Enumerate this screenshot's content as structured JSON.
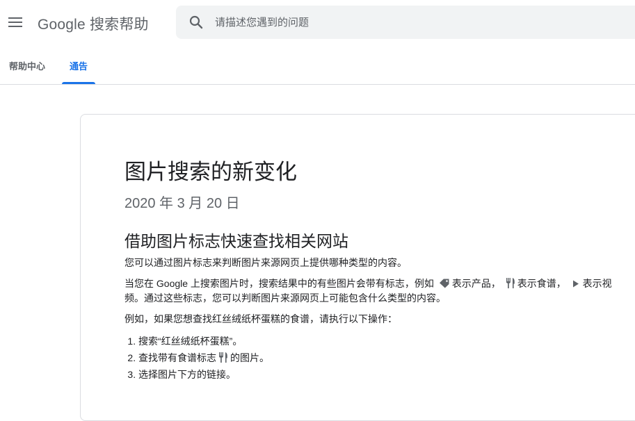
{
  "header": {
    "product_title": "Google 搜索帮助",
    "search_placeholder": "请描述您遇到的问题"
  },
  "tabs": [
    {
      "label": "帮助中心",
      "active": false
    },
    {
      "label": "通告",
      "active": true
    }
  ],
  "article": {
    "title": "图片搜索的新变化",
    "date": "2020 年 3 月 20 日",
    "section_heading": "借助图片标志快速查找相关网站",
    "intro": "您可以通过图片标志来判断图片来源网页上提供哪种类型的内容。",
    "badges_para": {
      "part1": "当您在 Google 上搜索图片时，搜索结果中的有些图片会带有标志，例如",
      "part2": "表示产品，",
      "part3": "表示食谱，",
      "part4": "表示视频。通过这些标志，您可以判断图片来源网页上可能包含什么类型的内容。"
    },
    "example_intro": "例如，如果您想查找红丝绒纸杯蛋糕的食谱，请执行以下操作：",
    "steps": {
      "step1": "搜索“红丝绒纸杯蛋糕”。",
      "step2_part1": "查找带有食谱标志",
      "step2_part2": "的图片。",
      "step3": "选择图片下方的链接。"
    }
  },
  "icons": {
    "menu": "menu-icon",
    "search": "search-icon",
    "product": "tag-icon",
    "recipe": "fork-knife-icon",
    "video": "play-icon"
  },
  "colors": {
    "accent": "#1a73e8",
    "search_bg": "#f1f3f4",
    "secondary_text": "#5f6368",
    "border": "#dadce0"
  }
}
